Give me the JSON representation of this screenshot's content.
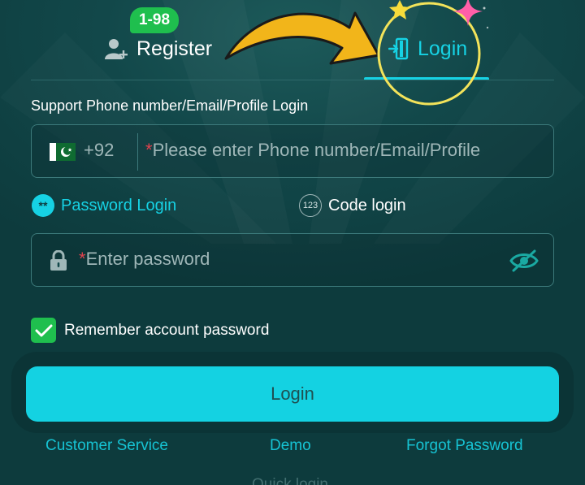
{
  "tabs": {
    "register_label": "Register",
    "register_badge": "1-98",
    "login_label": "Login",
    "active": "login"
  },
  "form": {
    "support_text": "Support Phone number/Email/Profile Login",
    "country_code": "+92",
    "country_flag": "pakistan-flag",
    "account_required_mark": "*",
    "account_placeholder": "Please enter Phone number/Email/Profile",
    "login_modes": {
      "password_label": "Password Login",
      "password_icon_text": "**",
      "code_label": "Code login",
      "code_icon_text": "123",
      "selected": "password"
    },
    "password_required_mark": "*",
    "password_placeholder": "Enter password",
    "remember_label": "Remember account password",
    "remember_checked": true,
    "submit_label": "Login"
  },
  "links": {
    "customer_service": "Customer Service",
    "demo": "Demo",
    "forgot_password": "Forgot Password",
    "quick_login": "Quick login"
  },
  "colors": {
    "background": "#0d3b3d",
    "accent": "#16d2e4",
    "success": "#1fbf4e",
    "highlight_ring": "#f3e35a",
    "arrow": "#f2b51a",
    "sparkle_pink": "#ff5fa8"
  }
}
